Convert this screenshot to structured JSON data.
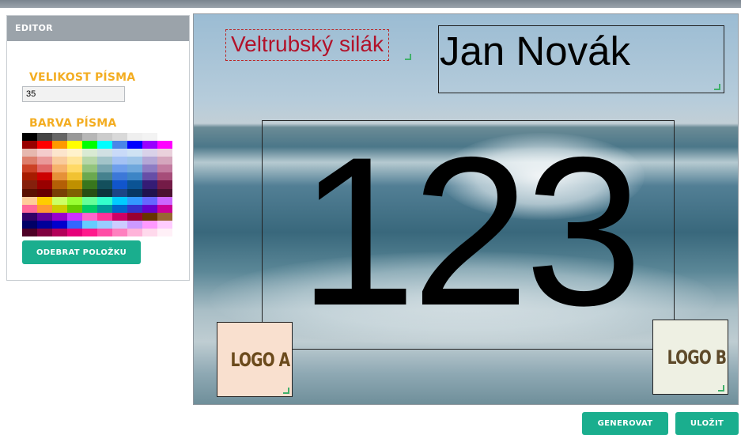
{
  "editor": {
    "title": "EDITOR",
    "font_size_label": "VELIKOST PÍSMA",
    "font_size_value": "35",
    "font_color_label": "BARVA PÍSMA",
    "remove_button": "ODEBRAT POLOŽKU",
    "palette": [
      "#000000",
      "#444444",
      "#666666",
      "#999999",
      "#b7b7b7",
      "#cccccc",
      "#d9d9d9",
      "#efefef",
      "#f3f3f3",
      "#ffffff",
      "#980000",
      "#ff0000",
      "#ff9900",
      "#ffff00",
      "#00ff00",
      "#00ffff",
      "#4a86e8",
      "#0000ff",
      "#9900ff",
      "#ff00ff",
      "#e6b8af",
      "#f4cccc",
      "#fce5cd",
      "#fff2cc",
      "#d9ead3",
      "#d0e0e3",
      "#c9daf8",
      "#cfe2f3",
      "#d9d2e9",
      "#ead1dc",
      "#dd7e6b",
      "#ea9999",
      "#f9cb9c",
      "#ffe599",
      "#b6d7a8",
      "#a2c4c9",
      "#a4c2f4",
      "#9fc5e8",
      "#b4a7d6",
      "#d5a6bd",
      "#cc4125",
      "#e06666",
      "#f6b26b",
      "#ffd966",
      "#93c47d",
      "#76a5af",
      "#6d9eeb",
      "#6fa8dc",
      "#8e7cc3",
      "#c27ba0",
      "#a61c00",
      "#cc0000",
      "#e69138",
      "#f1c232",
      "#6aa84f",
      "#45818e",
      "#3c78d8",
      "#3d85c6",
      "#674ea7",
      "#a64d79",
      "#85200c",
      "#990000",
      "#b45f06",
      "#bf9000",
      "#38761d",
      "#134f5c",
      "#1155cc",
      "#0b5394",
      "#351c75",
      "#741b47",
      "#5b0f00",
      "#660000",
      "#783f04",
      "#7f6000",
      "#274e13",
      "#0c343d",
      "#1c4587",
      "#073763",
      "#20124d",
      "#4c1130",
      "#ffcc99",
      "#ffcc00",
      "#ccff66",
      "#99ff33",
      "#66ff99",
      "#33ffcc",
      "#00ccff",
      "#3399ff",
      "#6666ff",
      "#cc66ff",
      "#ff6699",
      "#ff9933",
      "#cccc00",
      "#66cc00",
      "#00cc66",
      "#009999",
      "#0066cc",
      "#3333cc",
      "#6600cc",
      "#cc0099",
      "#330066",
      "#660099",
      "#9900cc",
      "#cc33ff",
      "#ff66cc",
      "#ff3399",
      "#cc0066",
      "#990033",
      "#663300",
      "#996633",
      "#000066",
      "#000099",
      "#0000cc",
      "#3366ff",
      "#66ccff",
      "#99ccff",
      "#ccccff",
      "#cc99ff",
      "#ff99ff",
      "#ffccff",
      "#4d0026",
      "#800040",
      "#b30059",
      "#e6007a",
      "#ff1a8c",
      "#ff4da6",
      "#ff80bf",
      "#ffb3d9",
      "#ffd9ec",
      "#fff0f7"
    ]
  },
  "canvas": {
    "event_text": "Veltrubský silák",
    "name_text": "Jan Novák",
    "number_text": "123",
    "logo_a": "LOGO A",
    "logo_b": "LOGO B"
  },
  "actions": {
    "generate": "GENEROVAT",
    "save": "ULOŽIT"
  },
  "colors": {
    "accent": "#1aae8e",
    "label": "#f3ad22",
    "event_text": "#b2122a"
  }
}
